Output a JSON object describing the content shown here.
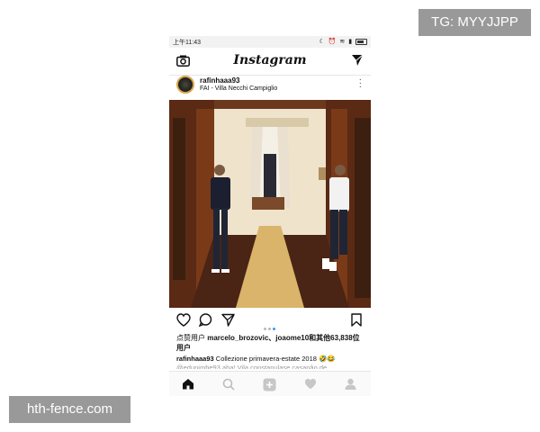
{
  "overlays": {
    "telegram_tag": "TG: MYYJJPP",
    "watermark": "hth-fence.com"
  },
  "status_bar": {
    "time": "上午11:43",
    "icons": [
      "moon-icon",
      "alarm-icon",
      "wifi-icon",
      "signal-icon",
      "battery-icon"
    ]
  },
  "app_bar": {
    "title": "Instagram",
    "left_icon": "camera-icon",
    "right_icon": "direct-send-icon"
  },
  "post": {
    "username": "rafinhaaa93",
    "location": "FAI - Villa Necchi Campiglio",
    "carousel": {
      "count": 3,
      "active": 3
    },
    "likes_prefix": "点赞用户 ",
    "likes_users": "marcelo_brozovic、joaome10",
    "likes_mid": "和其他",
    "likes_count": "63,838",
    "likes_suffix": "位用户",
    "caption_user": "rafinhaaa93",
    "caption_text": " Collezione primavera-estate 2018 🤣😂",
    "comment_preview": "@edunimhe93 aha! Vila constanulase casanâo de"
  },
  "colors": {
    "accent": "#3897f0",
    "avatar_ring": "#d6a64a",
    "overlay_bg": "#999999"
  },
  "tab_bar": {
    "items": [
      "home-icon",
      "search-icon",
      "add-icon",
      "heart-icon",
      "profile-icon"
    ],
    "active": "home-icon"
  }
}
